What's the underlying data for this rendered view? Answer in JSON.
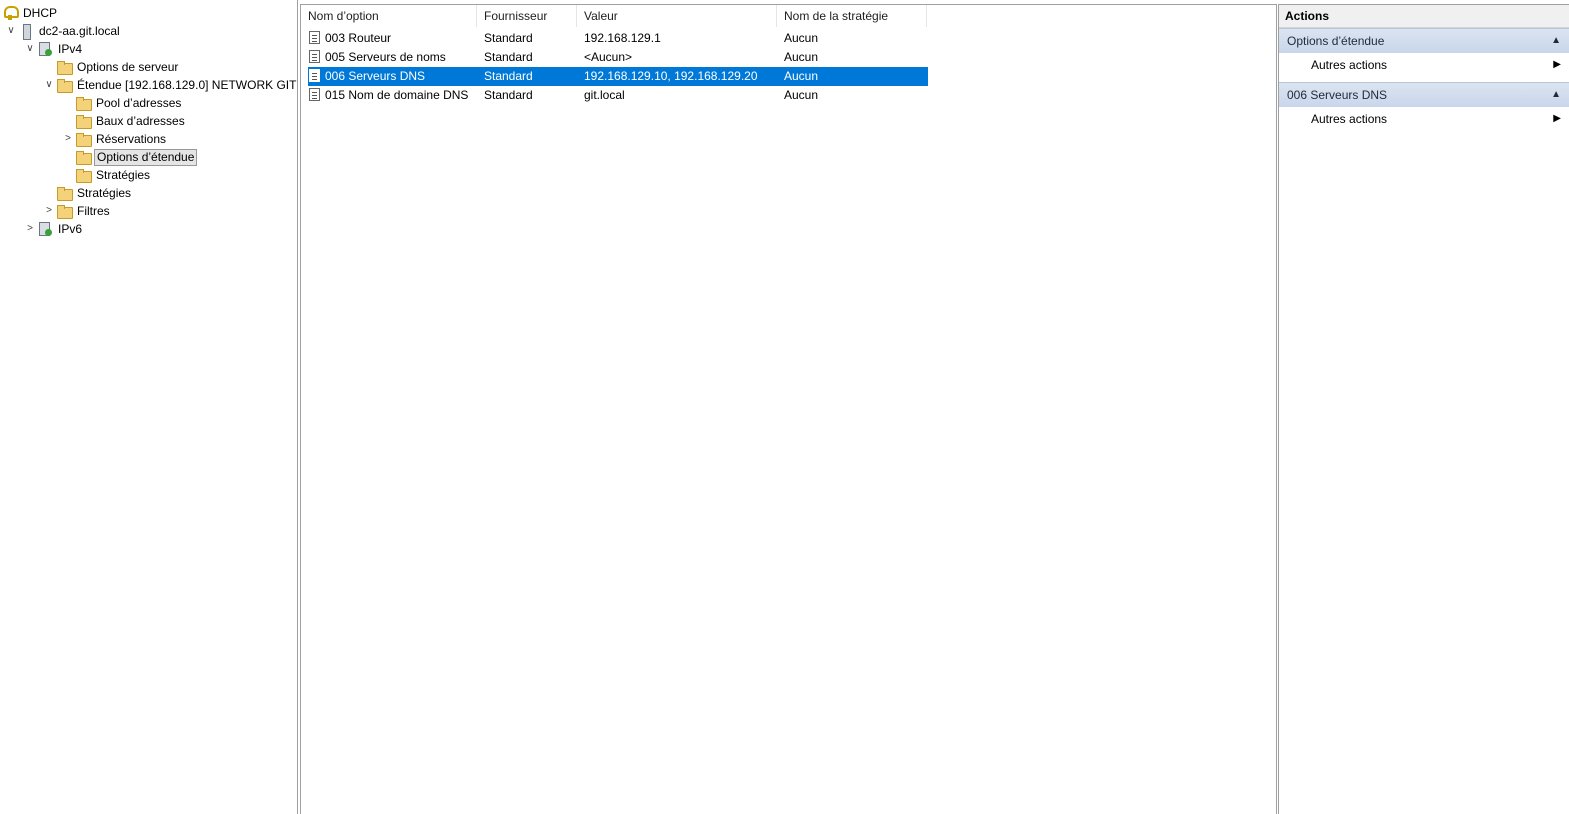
{
  "tree": {
    "root": "DHCP",
    "server": "dc2-aa.git.local",
    "ipv4": "IPv4",
    "server_options": "Options de serveur",
    "scope": "Étendue [192.168.129.0] NETWORK GIT",
    "pool": "Pool d’adresses",
    "leases": "Baux d’adresses",
    "reservations": "Réservations",
    "scope_options": "Options d’étendue",
    "scope_policies": "Stratégies",
    "policies": "Stratégies",
    "filters": "Filtres",
    "ipv6": "IPv6"
  },
  "list": {
    "columns": [
      "Nom d’option",
      "Fournisseur",
      "Valeur",
      "Nom de la stratégie"
    ],
    "rows": [
      {
        "name": "003 Routeur",
        "vendor": "Standard",
        "value": "192.168.129.1",
        "policy": "Aucun"
      },
      {
        "name": "005 Serveurs de noms",
        "vendor": "Standard",
        "value": "<Aucun>",
        "policy": "Aucun"
      },
      {
        "name": "006 Serveurs DNS",
        "vendor": "Standard",
        "value": "192.168.129.10, 192.168.129.20",
        "policy": "Aucun"
      },
      {
        "name": "015 Nom de domaine DNS",
        "vendor": "Standard",
        "value": "git.local",
        "policy": "Aucun"
      }
    ],
    "selected_index": 2
  },
  "actions": {
    "title": "Actions",
    "section1": "Options d’étendue",
    "section1_item": "Autres actions",
    "section2": "006 Serveurs DNS",
    "section2_item": "Autres actions"
  },
  "colors": {
    "selection": "#0078d7",
    "section_bg": "#c9d6ea"
  }
}
